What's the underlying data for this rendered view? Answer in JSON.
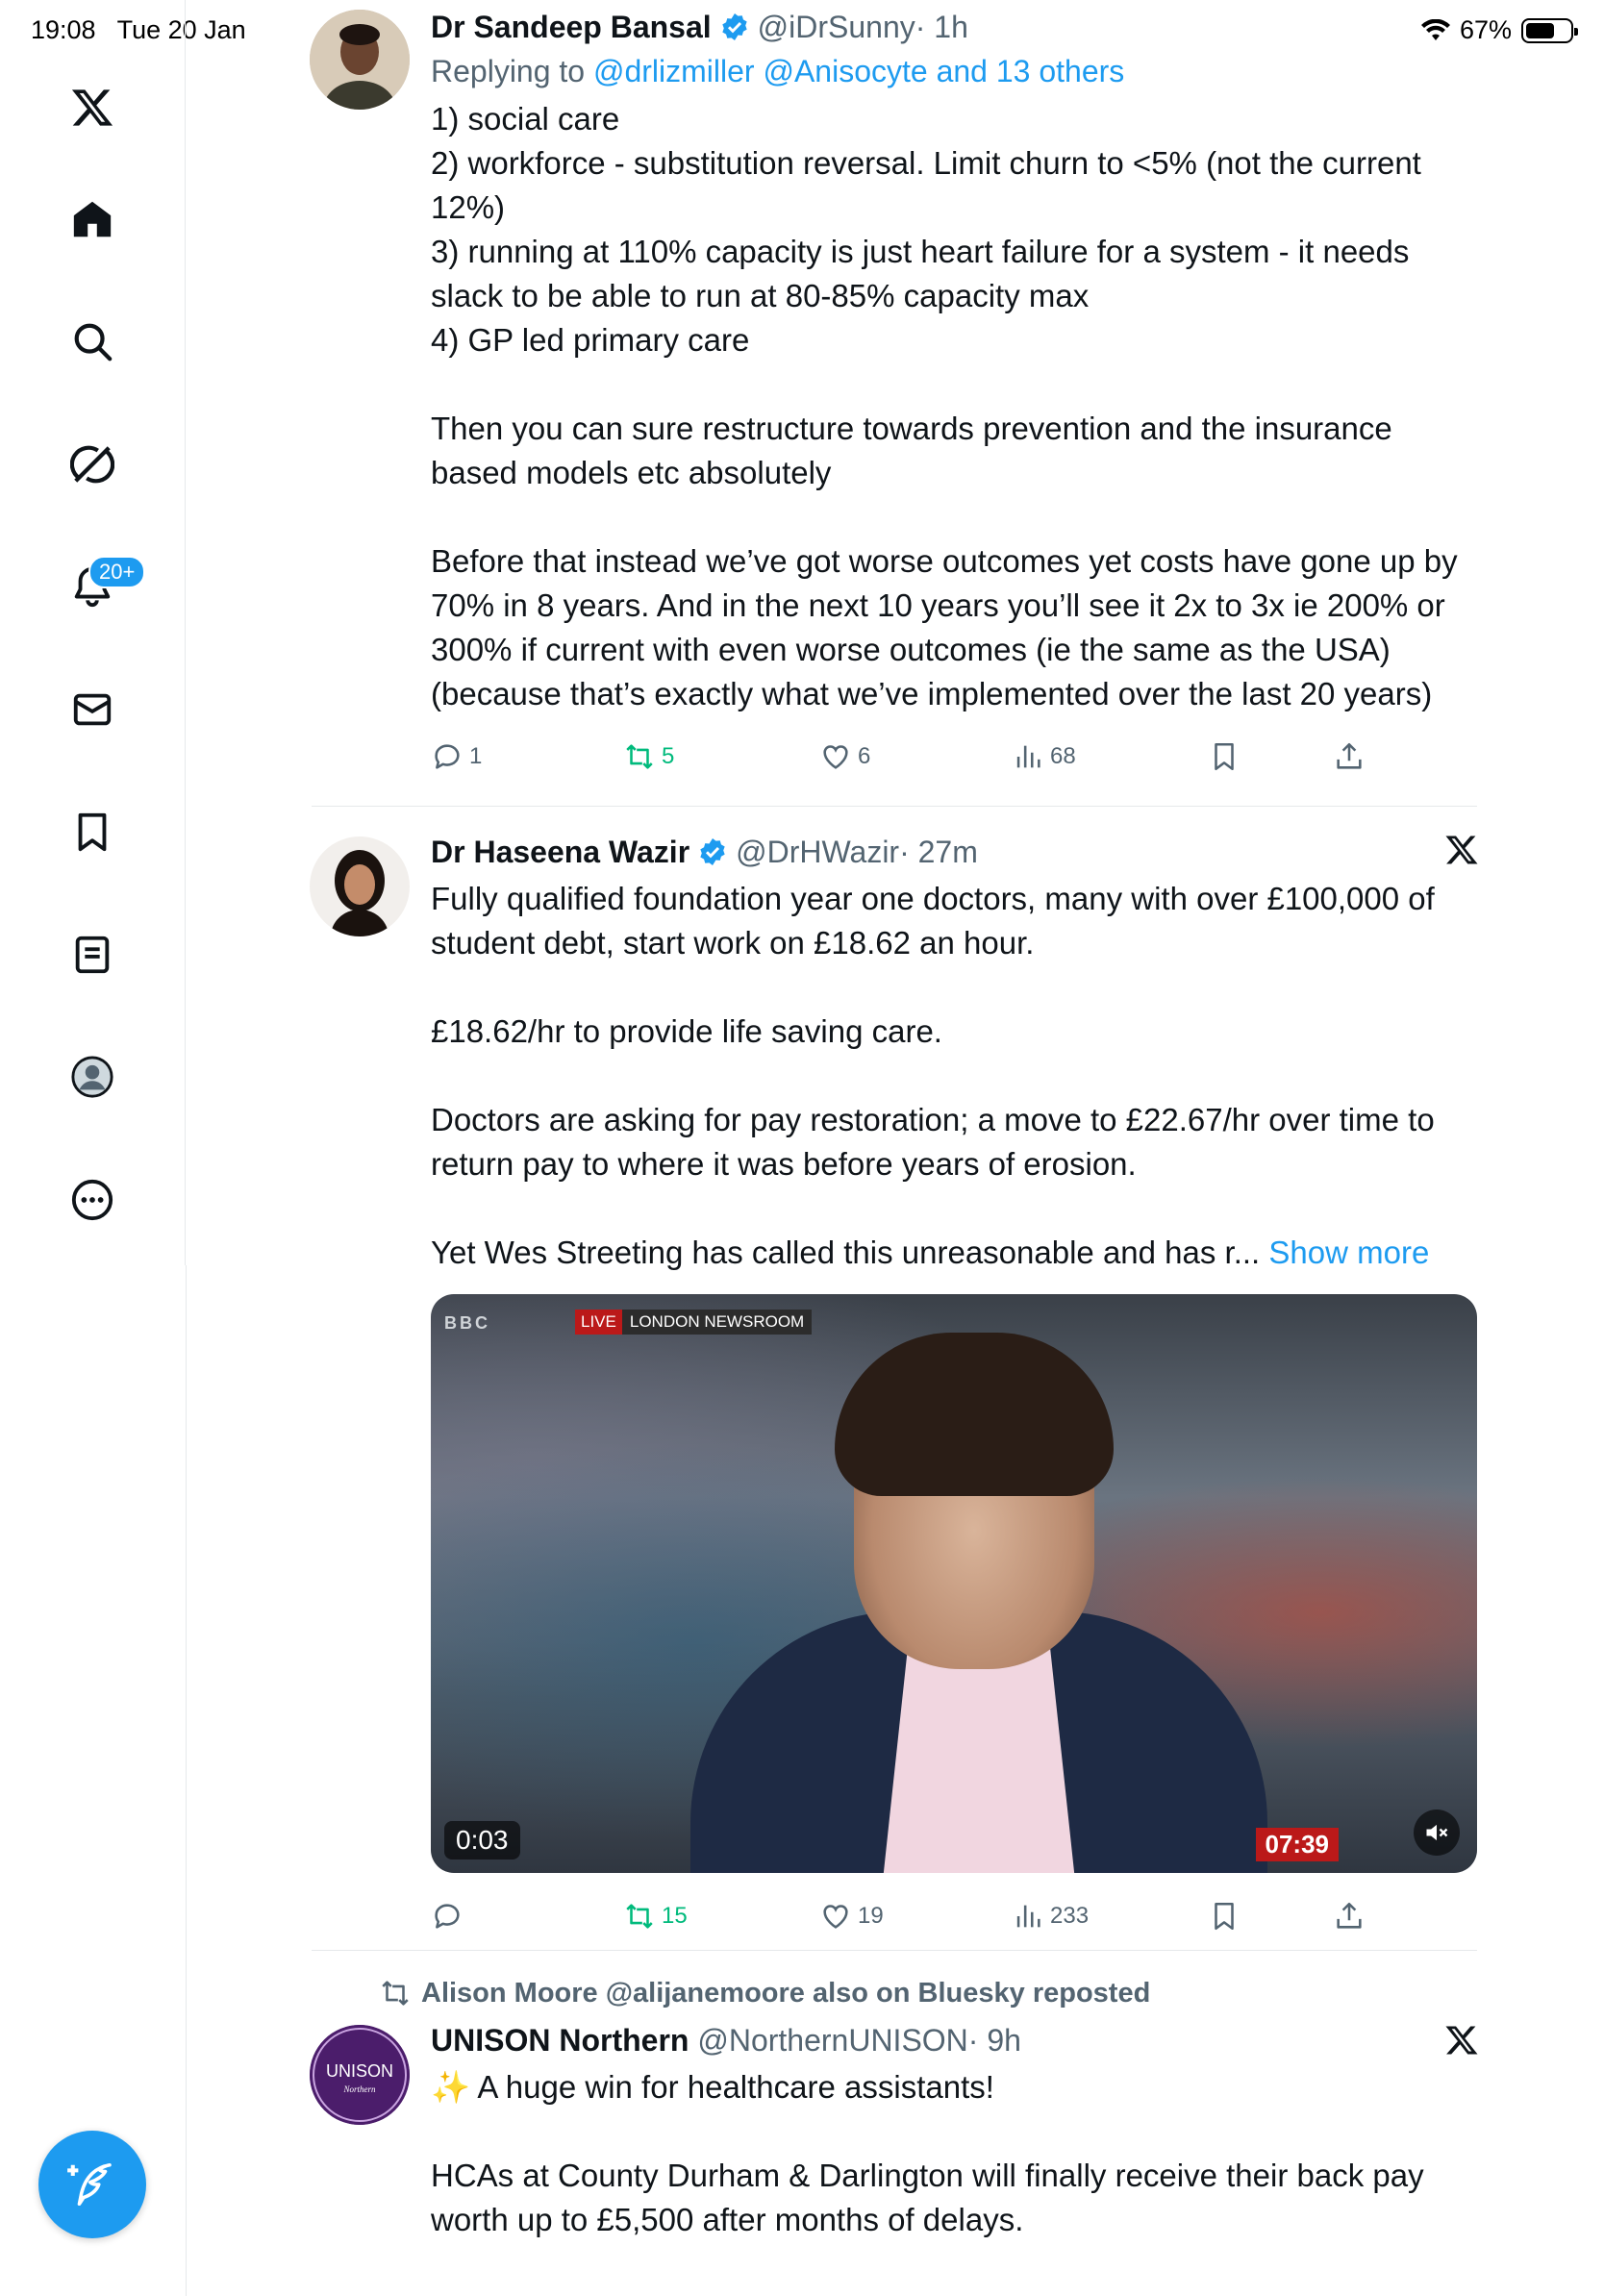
{
  "status_bar": {
    "time": "19:08",
    "date": "Tue 20 Jan",
    "battery": "67%",
    "battery_level": 0.67
  },
  "sidebar": {
    "items": [
      {
        "name": "x-logo"
      },
      {
        "name": "home"
      },
      {
        "name": "search"
      },
      {
        "name": "grok"
      },
      {
        "name": "notifications",
        "badge": "20+"
      },
      {
        "name": "messages"
      },
      {
        "name": "bookmarks"
      },
      {
        "name": "lists"
      },
      {
        "name": "profile"
      },
      {
        "name": "more"
      }
    ],
    "compose_icon": "compose-icon"
  },
  "tweets": [
    {
      "name": "Dr Sandeep Bansal",
      "handle": "@iDrSunny",
      "time": "· 1h",
      "replying_prefix": "Replying to ",
      "replying_to": "@drlizmiller @Anisocyte and 13 others",
      "lines": [
        "1) social care",
        "2) workforce - substitution reversal. Limit churn to <5% (not the current 12%)",
        "3) running at 110% capacity is just heart failure for a system - it needs slack to be able to run at 80-85% capacity max",
        "4) GP led primary care",
        "",
        "Then you can sure restructure towards prevention and the insurance based models etc absolutely",
        "",
        "Before that instead we’ve got worse outcomes yet costs have gone up by 70% in 8 years. And in the next 10 years you’ll see it 2x to 3x ie 200% or 300% if current with even worse outcomes (ie the same as the USA) (because that’s exactly what we’ve implemented over the last 20 years)"
      ],
      "replies": "1",
      "reposts": "5",
      "likes": "6",
      "views": "68"
    },
    {
      "name": "Dr Haseena Wazir",
      "handle": "@DrHWazir",
      "time": "· 27m",
      "lines": [
        "Fully qualified foundation year one doctors, many with over £100,000 of student debt, start work on £18.62 an hour.",
        "",
        "£18.62/hr to provide life saving care.",
        "",
        "Doctors are asking for pay restoration; a move to £22.67/hr over time to return pay to where it was before years of erosion.",
        ""
      ],
      "truncated_line": "Yet Wes Streeting has called this unreasonable and has r... ",
      "show_more": "Show more",
      "video": {
        "channel": "BBC",
        "live_label": "LIVE",
        "banner": "LONDON NEWSROOM",
        "elapsed": "0:03",
        "clock": "07:39"
      },
      "replies": "",
      "reposts": "15",
      "likes": "19",
      "views": "233"
    },
    {
      "repost_by": "Alison Moore @alijanemoore also on Bluesky reposted",
      "name": "UNISON Northern",
      "handle": "@NorthernUNISON",
      "time": "· 9h",
      "avatar_text": "UNISON",
      "avatar_subtext": "Northern",
      "lines": [
        "✨ A huge win for healthcare assistants!",
        "",
        "HCAs at County Durham & Darlington will finally receive their back pay worth up to £5,500 after months of delays."
      ]
    }
  ],
  "colors": {
    "accent": "#1d9bf0",
    "muted": "#536471",
    "repost_green": "#00ba7c",
    "text": "#0f1419"
  }
}
